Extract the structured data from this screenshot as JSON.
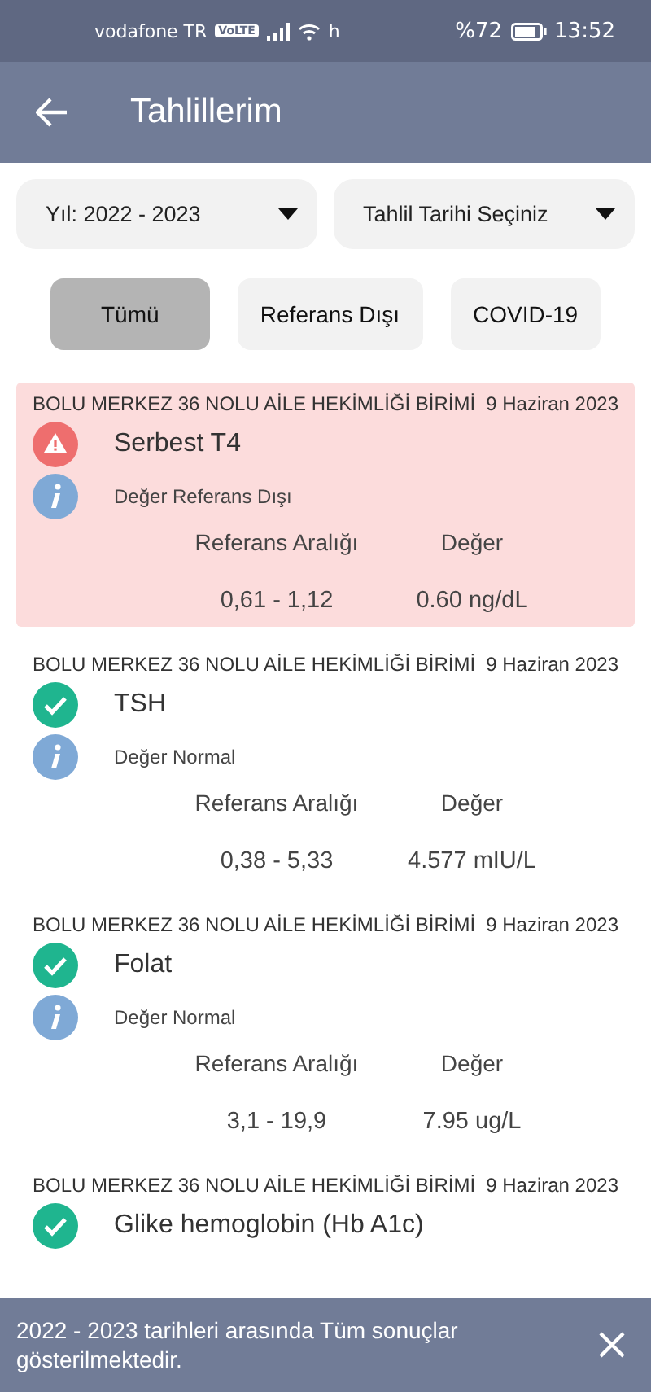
{
  "status_bar": {
    "carrier": "vodafone TR",
    "volte": "VoLTE",
    "network": "h",
    "battery": "%72",
    "time": "13:52"
  },
  "app_bar": {
    "title": "Tahlillerim"
  },
  "filters": {
    "year": "Yıl: 2022 - 2023",
    "date": "Tahlil Tarihi Seçiniz"
  },
  "tabs": [
    {
      "label": "Tümü",
      "selected": true
    },
    {
      "label": "Referans Dışı",
      "selected": false
    },
    {
      "label": "COVID-19",
      "selected": false
    }
  ],
  "results": [
    {
      "kind": "abnormal",
      "facility": "BOLU MERKEZ 36 NOLU AİLE HEKİMLİĞİ BİRİMİ",
      "date": "9 Haziran 2023",
      "test": "Serbest T4",
      "status": "Değer Referans Dışı",
      "range_label": "Referans Aralığı",
      "value_label": "Değer",
      "range": "0,61 - 1,12",
      "value": "0.60 ng/dL"
    },
    {
      "kind": "normal",
      "facility": "BOLU MERKEZ 36 NOLU AİLE HEKİMLİĞİ BİRİMİ",
      "date": "9 Haziran 2023",
      "test": "TSH",
      "status": "Değer Normal",
      "range_label": "Referans Aralığı",
      "value_label": "Değer",
      "range": "0,38 - 5,33",
      "value": "4.577 mIU/L"
    },
    {
      "kind": "normal",
      "facility": "BOLU MERKEZ 36 NOLU AİLE HEKİMLİĞİ BİRİMİ",
      "date": "9 Haziran 2023",
      "test": "Folat",
      "status": "Değer Normal",
      "range_label": "Referans Aralığı",
      "value_label": "Değer",
      "range": "3,1 - 19,9",
      "value": "7.95 ug/L"
    },
    {
      "kind": "normal",
      "facility": "BOLU MERKEZ 36 NOLU AİLE HEKİMLİĞİ BİRİMİ",
      "date": "9 Haziran 2023",
      "test": "Glike hemoglobin (Hb A1c)"
    }
  ],
  "snackbar": {
    "message": "2022 - 2023 tarihleri arasında Tüm sonuçlar gösterilmektedir."
  }
}
